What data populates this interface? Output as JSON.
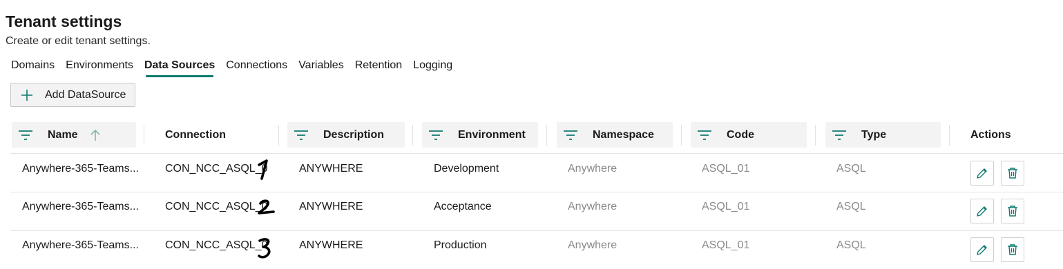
{
  "page": {
    "title": "Tenant settings",
    "subtitle": "Create or edit tenant settings."
  },
  "tabs": [
    {
      "label": "Domains"
    },
    {
      "label": "Environments"
    },
    {
      "label": "Data Sources",
      "active": true
    },
    {
      "label": "Connections"
    },
    {
      "label": "Variables"
    },
    {
      "label": "Retention"
    },
    {
      "label": "Logging"
    }
  ],
  "toolbar": {
    "add_label": "Add DataSource",
    "add_icon": "plus-icon"
  },
  "table": {
    "columns": [
      "Name",
      "Connection",
      "Description",
      "Environment",
      "Namespace",
      "Code",
      "Type",
      "Actions"
    ],
    "sorted_column": "Name",
    "sort_direction": "ascending",
    "rows": [
      {
        "name": "Anywhere-365-Teams...",
        "connection": "CON_NCC_ASQL_0",
        "annotation": "1",
        "description": "ANYWHERE",
        "environment": "Development",
        "namespace": "Anywhere",
        "code": "ASQL_01",
        "type": "ASQL"
      },
      {
        "name": "Anywhere-365-Teams...",
        "connection": "CON_NCC_ASQL_0",
        "annotation": "2",
        "description": "ANYWHERE",
        "environment": "Acceptance",
        "namespace": "Anywhere",
        "code": "ASQL_01",
        "type": "ASQL"
      },
      {
        "name": "Anywhere-365-Teams...",
        "connection": "CON_NCC_ASQL_0",
        "annotation": "3",
        "description": "ANYWHERE",
        "environment": "Production",
        "namespace": "Anywhere",
        "code": "ASQL_01",
        "type": "ASQL"
      }
    ],
    "row_actions": [
      "edit-icon",
      "delete-icon"
    ]
  },
  "colors": {
    "accent": "#0e7a6e",
    "muted_text": "#8a8a8a",
    "header_bg": "#f3f3f3"
  }
}
